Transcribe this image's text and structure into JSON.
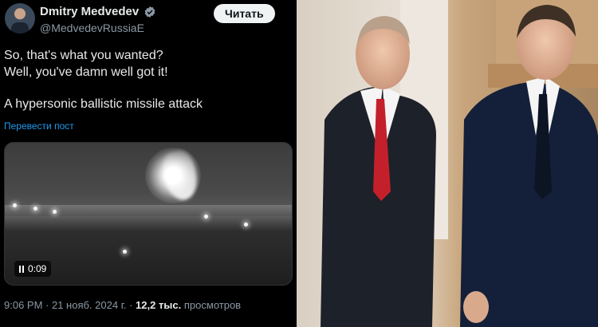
{
  "tweet": {
    "author_name": "Dmitry Medvedev",
    "author_handle": "@MedvedevRussiaE",
    "follow_label": "Читать",
    "lines": [
      "So, that's what you wanted?",
      "Well, you've damn well got it!",
      "A hypersonic ballistic missile attack"
    ],
    "translate_label": "Перевести пост",
    "video": {
      "duration": "0:09"
    },
    "timestamp": "9:06 PM · 21 нояб. 2024 г. ·",
    "view_count": "12,2 тыс.",
    "views_label": "просмотров"
  },
  "colors": {
    "background": "#000000",
    "text": "#e7e9ea",
    "secondary_text": "#8b98a5",
    "link": "#1d9bf0",
    "verified_badge": "#8b98a5",
    "button_bg": "#eff3f4"
  },
  "icons": [
    "verified-badge-icon",
    "pause-icon"
  ]
}
